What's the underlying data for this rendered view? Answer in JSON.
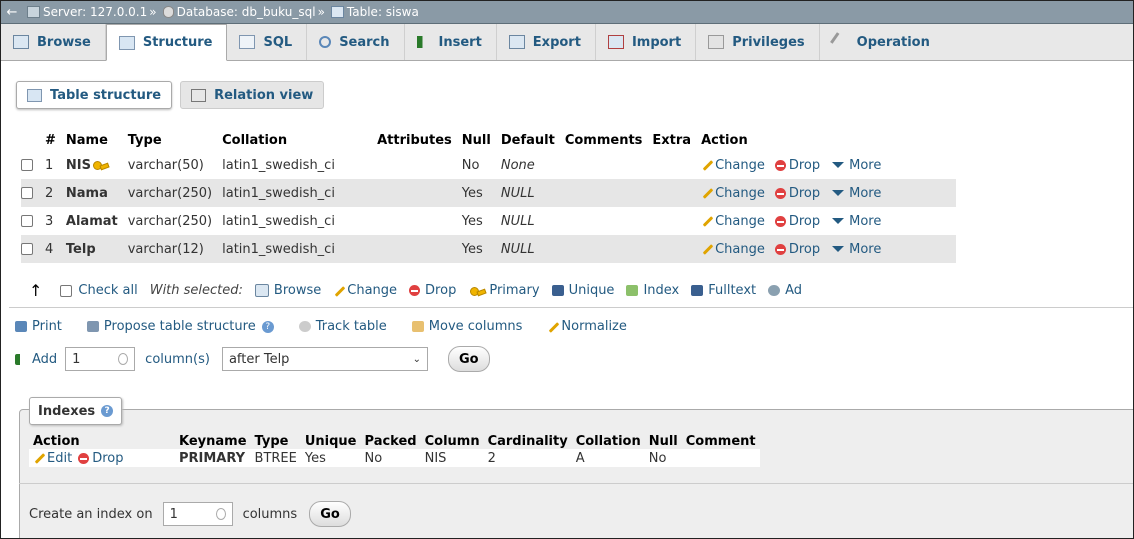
{
  "breadcrumb": {
    "back": "←",
    "server": "Server: 127.0.0.1",
    "database": "Database: db_buku_sql",
    "table": "Table: siswa",
    "sep": "»"
  },
  "tabs": [
    {
      "label": "Browse",
      "icon": "browse-icon"
    },
    {
      "label": "Structure",
      "icon": "structure-icon"
    },
    {
      "label": "SQL",
      "icon": "sql-icon"
    },
    {
      "label": "Search",
      "icon": "search-icon"
    },
    {
      "label": "Insert",
      "icon": "insert-icon"
    },
    {
      "label": "Export",
      "icon": "export-icon"
    },
    {
      "label": "Import",
      "icon": "import-icon"
    },
    {
      "label": "Privileges",
      "icon": "privileges-icon"
    },
    {
      "label": "Operation",
      "icon": "operations-icon"
    }
  ],
  "subtabs": {
    "structure": "Table structure",
    "relation": "Relation view"
  },
  "structure": {
    "headers": [
      "#",
      "Name",
      "Type",
      "Collation",
      "Attributes",
      "Null",
      "Default",
      "Comments",
      "Extra",
      "Action"
    ],
    "rows": [
      {
        "num": "1",
        "name": "NIS",
        "type": "varchar(50)",
        "collation": "latin1_swedish_ci",
        "attributes": "",
        "null": "No",
        "default": "None",
        "comments": "",
        "extra": ""
      },
      {
        "num": "2",
        "name": "Nama",
        "type": "varchar(250)",
        "collation": "latin1_swedish_ci",
        "attributes": "",
        "null": "Yes",
        "default": "NULL",
        "comments": "",
        "extra": ""
      },
      {
        "num": "3",
        "name": "Alamat",
        "type": "varchar(250)",
        "collation": "latin1_swedish_ci",
        "attributes": "",
        "null": "Yes",
        "default": "NULL",
        "comments": "",
        "extra": ""
      },
      {
        "num": "4",
        "name": "Telp",
        "type": "varchar(12)",
        "collation": "latin1_swedish_ci",
        "attributes": "",
        "null": "Yes",
        "default": "NULL",
        "comments": "",
        "extra": ""
      }
    ],
    "actions": {
      "change": "Change",
      "drop": "Drop",
      "more": "More"
    }
  },
  "with_selected": {
    "check_all": "Check all",
    "label": "With selected:",
    "browse": "Browse",
    "change": "Change",
    "drop": "Drop",
    "primary": "Primary",
    "unique": "Unique",
    "index": "Index",
    "fulltext": "Fulltext",
    "add": "Ad"
  },
  "actions_row": {
    "print": "Print",
    "propose": "Propose table structure",
    "track": "Track table",
    "move": "Move columns",
    "normalize": "Normalize"
  },
  "add_column": {
    "label": "Add",
    "count": "1",
    "unit": "column(s)",
    "position": "after Telp",
    "go": "Go"
  },
  "indexes": {
    "legend": "Indexes",
    "headers": [
      "Action",
      "Keyname",
      "Type",
      "Unique",
      "Packed",
      "Column",
      "Cardinality",
      "Collation",
      "Null",
      "Comment"
    ],
    "row": {
      "edit": "Edit",
      "drop": "Drop",
      "keyname": "PRIMARY",
      "type": "BTREE",
      "unique": "Yes",
      "packed": "No",
      "column": "NIS",
      "cardinality": "2",
      "collation": "A",
      "null": "No",
      "comment": ""
    },
    "create_label": "Create an index on",
    "create_count": "1",
    "create_unit": "columns",
    "go": "Go"
  }
}
